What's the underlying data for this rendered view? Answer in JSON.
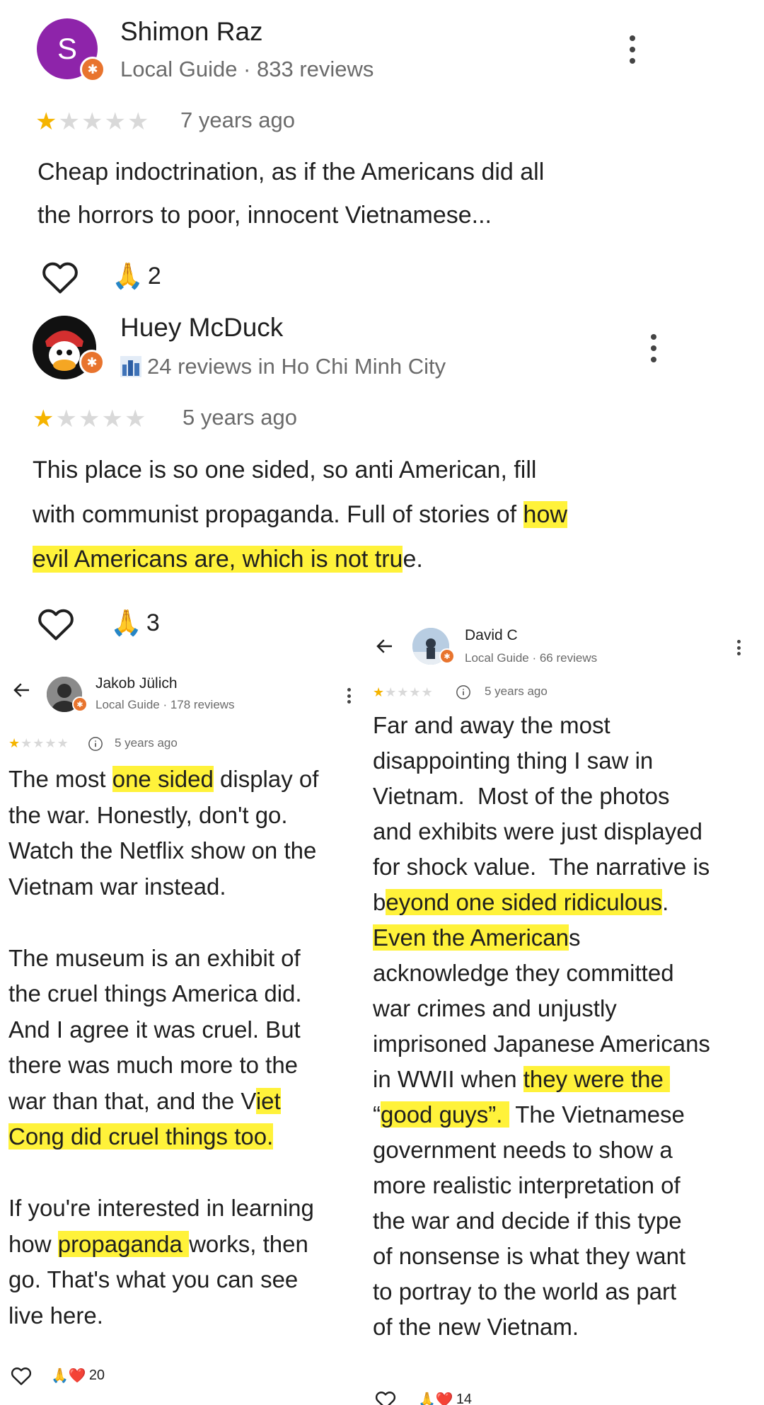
{
  "reviews": [
    {
      "author": "Shimon Raz",
      "avatar_letter": "S",
      "avatar_color": "#8e24aa",
      "meta": "Local Guide · 833 reviews",
      "rating": 1,
      "time": "7 years ago",
      "text_lines": [
        "Cheap indoctrination, as if the Americans did all",
        "the horrors to poor, innocent Vietnamese..."
      ],
      "reaction_count": "2",
      "reaction_emoji": "🙏"
    },
    {
      "author": "Huey McDuck",
      "meta": "24 reviews in Ho Chi Minh City",
      "meta_icon": "city-icon",
      "rating": 1,
      "time": "5 years ago",
      "text_line1": "This place is so one sided, so anti American, fill",
      "text_line2_plain": "with communist propaganda. Full of stories of ",
      "text_line2_hl": "how",
      "text_line3_hl": "evil Americans are, which is not tru",
      "text_line3_plain": "e.",
      "reaction_count": "3",
      "reaction_emoji": "🙏"
    },
    {
      "author": "Jakob Jülich",
      "meta": "Local Guide · 178 reviews",
      "rating": 1,
      "time": "5 years ago",
      "p1_a": "The most ",
      "p1_hl": "one sided",
      "p1_b": " display of",
      "p1_l2": "the war. Honestly, don't go.",
      "p1_l3": "Watch the Netflix show on the",
      "p1_l4": "Vietnam war instead.",
      "p2_l1": "The museum is an exhibit of",
      "p2_l2": "the cruel things America did.",
      "p2_l3": "And I agree it was cruel. But",
      "p2_l4": "there was much more to the",
      "p2_l5a": "war than that, and the V",
      "p2_l5hl": "iet",
      "p2_l6hl": "Cong did cruel things too.",
      "p3_l1": "If you're interested in learning",
      "p3_l2a": "how ",
      "p3_l2hl": "propaganda ",
      "p3_l2b": "works, then",
      "p3_l3": "go. That's what you can see",
      "p3_l4": "live here.",
      "reaction_count": "20",
      "reaction_emoji": "🙏❤️"
    },
    {
      "author": "David C",
      "meta": "Local Guide · 66 reviews",
      "rating": 1,
      "time": "5 years ago",
      "l1": "Far and away the most",
      "l2": "disappointing thing I saw in",
      "l3": "Vietnam.  Most of the photos",
      "l4": "and exhibits were just displayed",
      "l5": "for shock value.  The narrative is",
      "l6a": "b",
      "l6hl": "eyond one sided ridiculous",
      "l6b": ".",
      "l7hl": "Even the American",
      "l7b": "s",
      "l8": "acknowledge they committed",
      "l9": "war crimes and unjustly",
      "l10": "imprisoned Japanese Americans",
      "l11a": "in WWII when ",
      "l11hl": "they were the ",
      "l12a": "“",
      "l12hl": "good guys”. ",
      "l12b": " The Vietnamese",
      "l13": "government needs to show a",
      "l14": "more realistic interpretation of",
      "l15": "the war and decide if this type",
      "l16": "of nonsense is what they want",
      "l17": "to portray to the world as part",
      "l18": "of the new Vietnam.",
      "reaction_count": "14",
      "reaction_emoji": "🙏❤️"
    }
  ],
  "colors": {
    "highlight": "#fff23a",
    "star_filled": "#f5b400",
    "star_empty": "#d9d9d9",
    "local_guide_badge": "#e8742e"
  },
  "icons": {
    "heart": "heart-outline-icon",
    "back": "back-arrow-icon",
    "more": "more-vert-icon",
    "info": "info-icon"
  }
}
